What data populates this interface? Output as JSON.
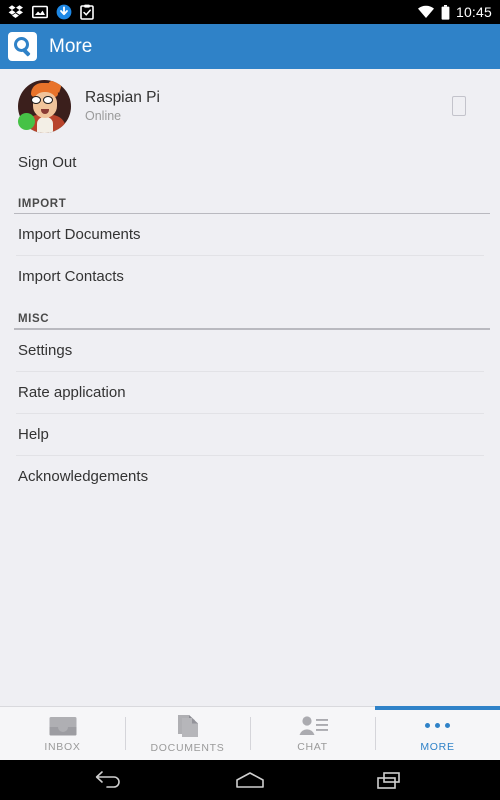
{
  "statusbar": {
    "time": "10:45",
    "left_icons": [
      "dropbox-icon",
      "screenshot-icon",
      "download-icon",
      "clipboard-icon"
    ],
    "right_icons": [
      "wifi-icon",
      "battery-icon"
    ]
  },
  "appbar": {
    "title": "More",
    "logo": "quickoffice-q-logo",
    "background_color": "#2F82C8"
  },
  "profile": {
    "name": "Raspian Pi",
    "status": "Online",
    "status_color": "#46C246",
    "avatar": "user-avatar",
    "action_icon": "edit-placeholder-icon"
  },
  "menu": {
    "sign_out": "Sign Out",
    "sections": [
      {
        "header": "IMPORT",
        "items": [
          "Import Documents",
          "Import Contacts"
        ]
      },
      {
        "header": "MISC",
        "items": [
          "Settings",
          "Rate application",
          "Help",
          "Acknowledgements"
        ]
      }
    ]
  },
  "tabbar": {
    "active_color": "#2F82C8",
    "inactive_color": "#9a9a9a",
    "tabs": [
      {
        "label": "INBOX",
        "icon": "inbox-tray-icon",
        "active": false
      },
      {
        "label": "DOCUMENTS",
        "icon": "documents-icon",
        "active": false
      },
      {
        "label": "CHAT",
        "icon": "contact-card-icon",
        "active": false
      },
      {
        "label": "MORE",
        "icon": "more-dots-icon",
        "active": true
      }
    ]
  },
  "navbar": {
    "buttons": [
      "back-button",
      "home-button",
      "recents-button"
    ]
  }
}
